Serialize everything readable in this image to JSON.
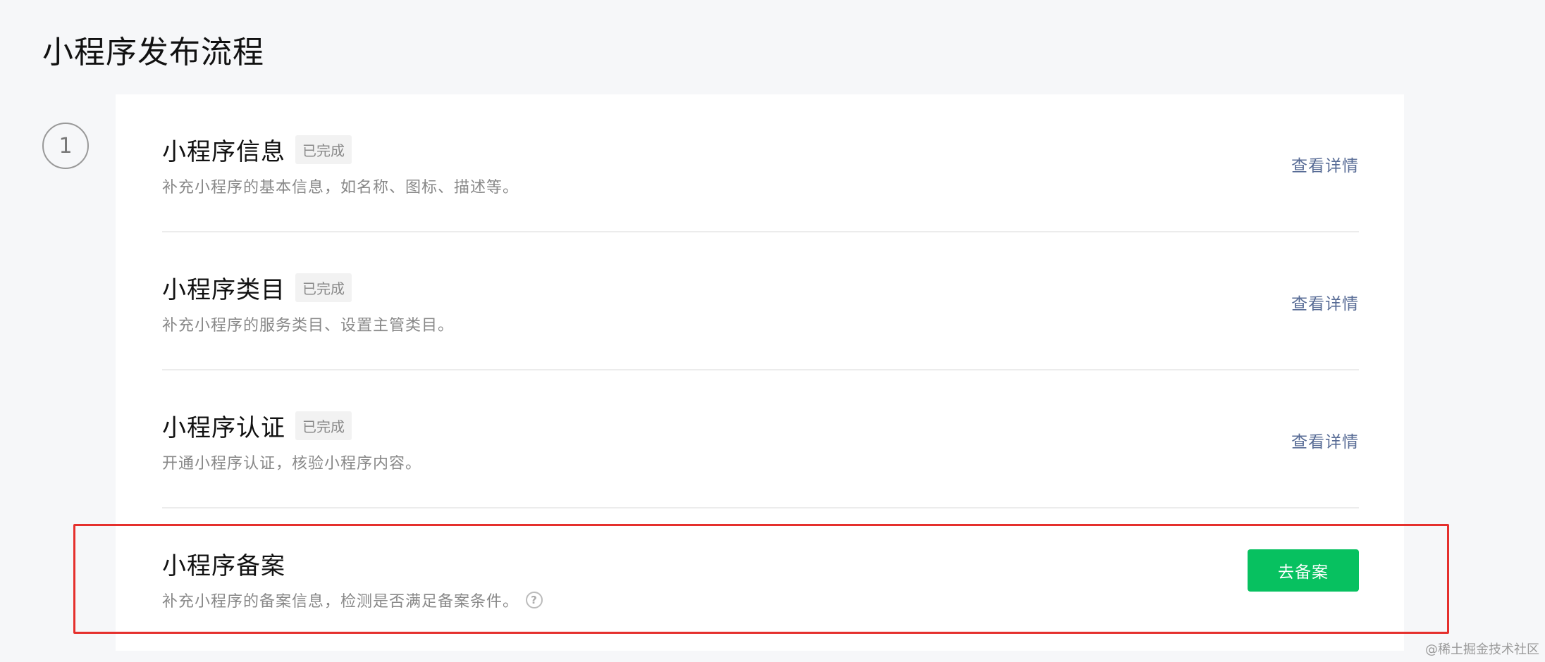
{
  "page": {
    "title": "小程序发布流程"
  },
  "step": {
    "number": "1"
  },
  "sections": [
    {
      "title": "小程序信息",
      "badge": "已完成",
      "description": "补充小程序的基本信息，如名称、图标、描述等。",
      "action_label": "查看详情"
    },
    {
      "title": "小程序类目",
      "badge": "已完成",
      "description": "补充小程序的服务类目、设置主管类目。",
      "action_label": "查看详情"
    },
    {
      "title": "小程序认证",
      "badge": "已完成",
      "description": "开通小程序认证，核验小程序内容。",
      "action_label": "查看详情"
    },
    {
      "title": "小程序备案",
      "description": "补充小程序的备案信息，检测是否满足备案条件。",
      "action_label": "去备案",
      "help_icon": "question-circle-icon"
    }
  ],
  "watermark": "@稀土掘金技术社区",
  "colors": {
    "primary": "#07c160",
    "link": "#576b95",
    "highlight": "#e5302d"
  }
}
